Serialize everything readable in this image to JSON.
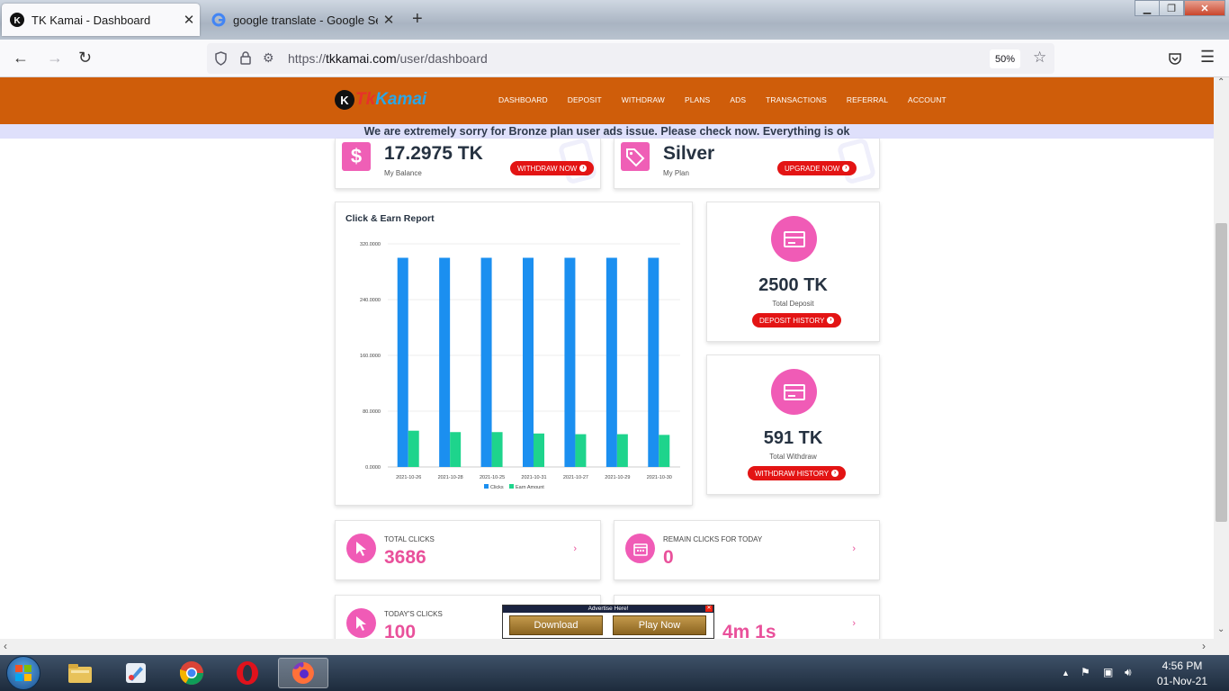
{
  "browser": {
    "tabs": [
      {
        "title": "TK Kamai - Dashboard",
        "active": true
      },
      {
        "title": "google translate - Google Search",
        "active": false
      }
    ],
    "url_prefix": "https://",
    "url_host": "tkkamai.com",
    "url_path": "/user/dashboard",
    "zoom": "50%"
  },
  "site": {
    "logo_tk": "Tk",
    "logo_name": "Kamai",
    "menu": [
      "DASHBOARD",
      "DEPOSIT",
      "WITHDRAW",
      "PLANS",
      "ADS",
      "TRANSACTIONS",
      "REFERRAL",
      "ACCOUNT"
    ],
    "notice": "We are extremely sorry for Bronze plan user ads issue. Please check now. Everything is ok"
  },
  "balance": {
    "value": "17.2975 TK",
    "label": "My Balance",
    "button": "WITHDRAW NOW",
    "icon": "dollar-icon"
  },
  "plan": {
    "value": "Silver",
    "label": "My Plan",
    "button": "UPGRADE NOW",
    "icon": "tag-icon"
  },
  "chart_title": "Click & Earn Report",
  "chart_data": {
    "type": "bar",
    "categories": [
      "2021-10-26",
      "2021-10-28",
      "2021-10-25",
      "2021-10-31",
      "2021-10-27",
      "2021-10-29",
      "2021-10-30"
    ],
    "series": [
      {
        "name": "Clicks",
        "color": "#1b8ff0",
        "values": [
          300,
          300,
          300,
          300,
          300,
          300,
          300
        ]
      },
      {
        "name": "Earn Amount",
        "color": "#1ed48c",
        "values": [
          52,
          50,
          50,
          48,
          47,
          47,
          46
        ]
      }
    ],
    "ylim": [
      0,
      320
    ],
    "yticks": [
      "0.0000",
      "80.0000",
      "160.0000",
      "240.0000",
      "320.0000"
    ],
    "grid": true,
    "legend": "bottom"
  },
  "deposit": {
    "value": "2500 TK",
    "label": "Total Deposit",
    "button": "DEPOSIT HISTORY"
  },
  "withdraw": {
    "value": "591 TK",
    "label": "Total Withdraw",
    "button": "WITHDRAW HISTORY"
  },
  "total_clicks": {
    "label": "TOTAL CLICKS",
    "value": "3686"
  },
  "remain_clicks": {
    "label": "REMAIN CLICKS FOR TODAY",
    "value": "0"
  },
  "today_clicks": {
    "label": "TODAY'S CLICKS",
    "value": "100"
  },
  "timer": {
    "value": "4m 1s"
  },
  "ad": {
    "header": "Advertise Here!",
    "download": "Download",
    "play": "Play Now"
  },
  "taskbar": {
    "time": "4:56 PM",
    "date": "01-Nov-21"
  },
  "colors": {
    "nav": "#cf5d0a",
    "accent": "#f05bb6",
    "button": "#e31414",
    "clicks": "#1b8ff0",
    "earn": "#1ed48c"
  }
}
